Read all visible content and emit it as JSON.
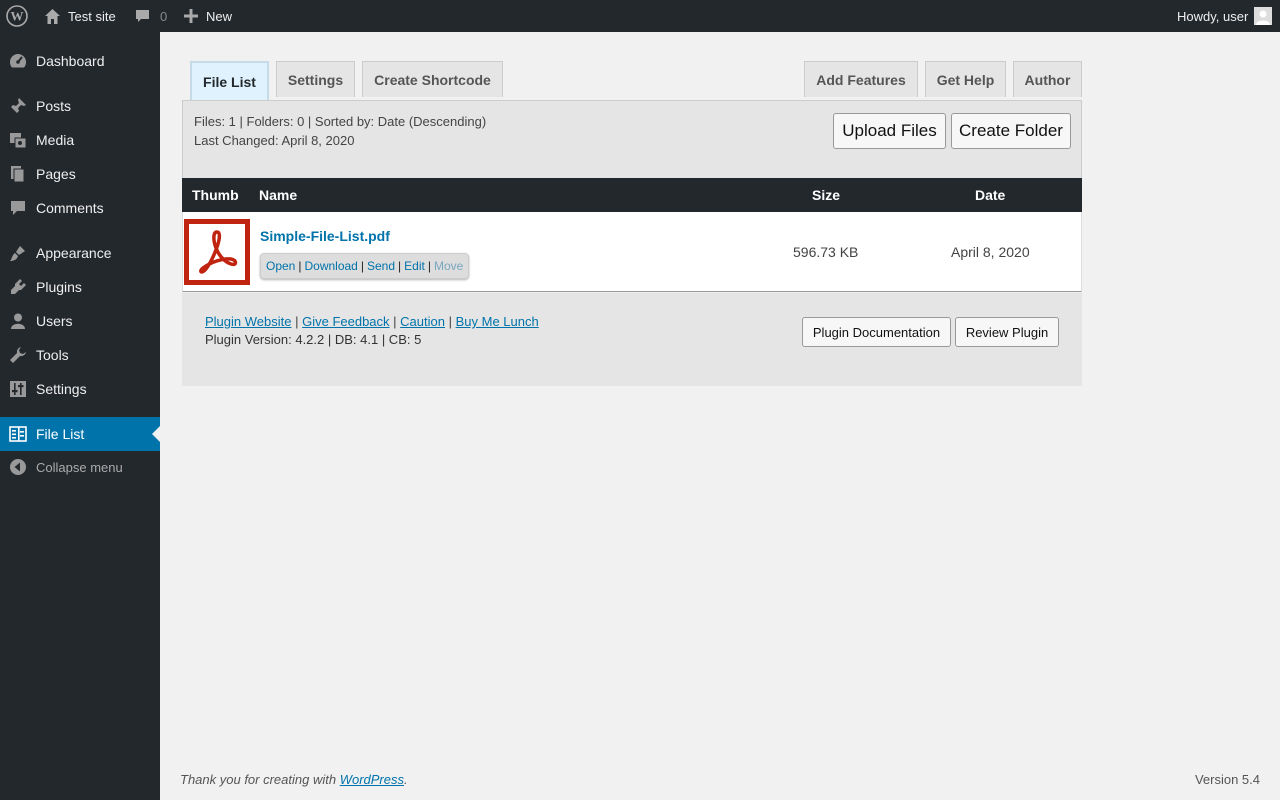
{
  "adminbar": {
    "site_name": "Test site",
    "comment_count": "0",
    "new_label": "New",
    "greeting": "Howdy, user"
  },
  "sidebar": {
    "items": [
      {
        "label": "Dashboard",
        "icon": "dashboard-icon"
      },
      {
        "label": "Posts",
        "icon": "pin-icon"
      },
      {
        "label": "Media",
        "icon": "media-icon"
      },
      {
        "label": "Pages",
        "icon": "pages-icon"
      },
      {
        "label": "Comments",
        "icon": "comment-icon"
      },
      {
        "label": "Appearance",
        "icon": "brush-icon"
      },
      {
        "label": "Plugins",
        "icon": "plug-icon"
      },
      {
        "label": "Users",
        "icon": "user-icon"
      },
      {
        "label": "Tools",
        "icon": "wrench-icon"
      },
      {
        "label": "Settings",
        "icon": "sliders-icon"
      },
      {
        "label": "File List",
        "icon": "file-list-icon"
      }
    ],
    "collapse_label": "Collapse menu"
  },
  "tabs": {
    "file_list": "File List",
    "settings": "Settings",
    "create_shortcode": "Create Shortcode",
    "add_features": "Add Features",
    "get_help": "Get Help",
    "author": "Author"
  },
  "panel": {
    "summary": "Files: 1 | Folders: 0 | Sorted by: Date (Descending)",
    "last_changed": "Last Changed: April 8, 2020",
    "upload_label": "Upload Files",
    "create_folder_label": "Create Folder"
  },
  "table": {
    "headers": {
      "thumb": "Thumb",
      "name": "Name",
      "size": "Size",
      "date": "Date"
    },
    "rows": [
      {
        "name": "Simple-File-List.pdf",
        "size": "596.73 KB",
        "date": "April 8, 2020",
        "actions": {
          "open": "Open",
          "download": "Download",
          "send": "Send",
          "edit": "Edit",
          "move": "Move"
        }
      }
    ]
  },
  "bottom": {
    "links": {
      "website": "Plugin Website",
      "feedback": "Give Feedback",
      "caution": "Caution",
      "lunch": "Buy Me Lunch"
    },
    "version_info": "Plugin Version: 4.2.2 | DB: 4.1 | CB: 5",
    "docs_label": "Plugin Documentation",
    "review_label": "Review Plugin"
  },
  "footer": {
    "thanks_prefix": "Thank you for creating with ",
    "wp_link": "WordPress",
    "thanks_suffix": ".",
    "version": "Version 5.4"
  },
  "colors": {
    "admin_dark": "#23282d",
    "accent_blue": "#0073aa",
    "pdf_red": "#c0230f"
  }
}
